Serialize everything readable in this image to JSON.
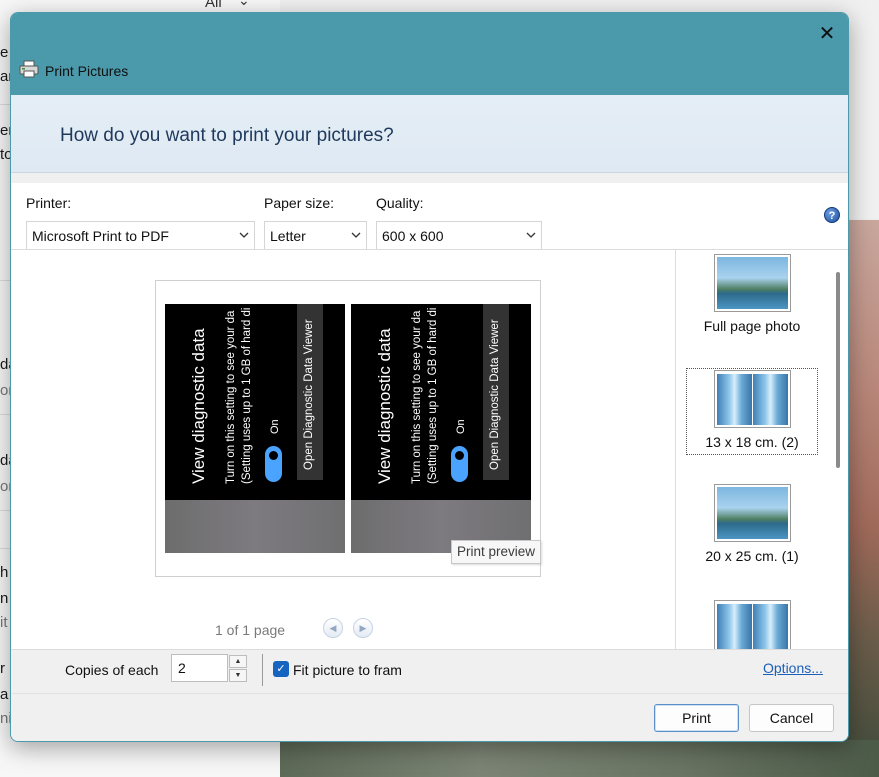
{
  "background": {
    "top_filter": "All",
    "fragments": [
      "e",
      "ar",
      "er",
      "to",
      "da",
      "or",
      "da",
      "or",
      "h",
      "n",
      "it",
      "r",
      "a",
      "ni"
    ]
  },
  "dialog": {
    "title": "Print Pictures",
    "close_glyph": "✕",
    "question": "How do you want to print your pictures?",
    "printer": {
      "label": "Printer:",
      "value": "Microsoft Print to PDF"
    },
    "paper_size": {
      "label": "Paper size:",
      "value": "Letter"
    },
    "quality": {
      "label": "Quality:",
      "value": "600 x 600"
    },
    "help_glyph": "?",
    "preview": {
      "photo": {
        "title": "View diagnostic data",
        "line1": "Turn on this setting to see your da",
        "line2": "(Setting uses up to 1 GB of hard di",
        "toggle_label": "On",
        "button_label": "Open Diagnostic Data Viewer"
      },
      "page_count": "1 of 1 page",
      "tooltip": "Print preview",
      "prev_glyph": "◀",
      "next_glyph": "▶"
    },
    "layouts": [
      {
        "caption": "Full page photo",
        "icon": "full-page-photo-icon",
        "selected": false
      },
      {
        "caption": "13 x 18 cm. (2)",
        "icon": "two-photo-icon",
        "selected": true
      },
      {
        "caption": "20 x 25 cm. (1)",
        "icon": "single-photo-icon",
        "selected": false
      },
      {
        "caption": "",
        "icon": "two-photo-icon",
        "selected": false
      }
    ],
    "copies": {
      "label": "Copies of each",
      "value": "2"
    },
    "fit": {
      "label": "Fit picture to fram",
      "checked": true
    },
    "options_link": "Options...",
    "print_button": "Print",
    "cancel_button": "Cancel"
  },
  "colors": {
    "titlebar": "#4a9aab",
    "accent": "#1565c0",
    "link": "#1c5fb8"
  }
}
